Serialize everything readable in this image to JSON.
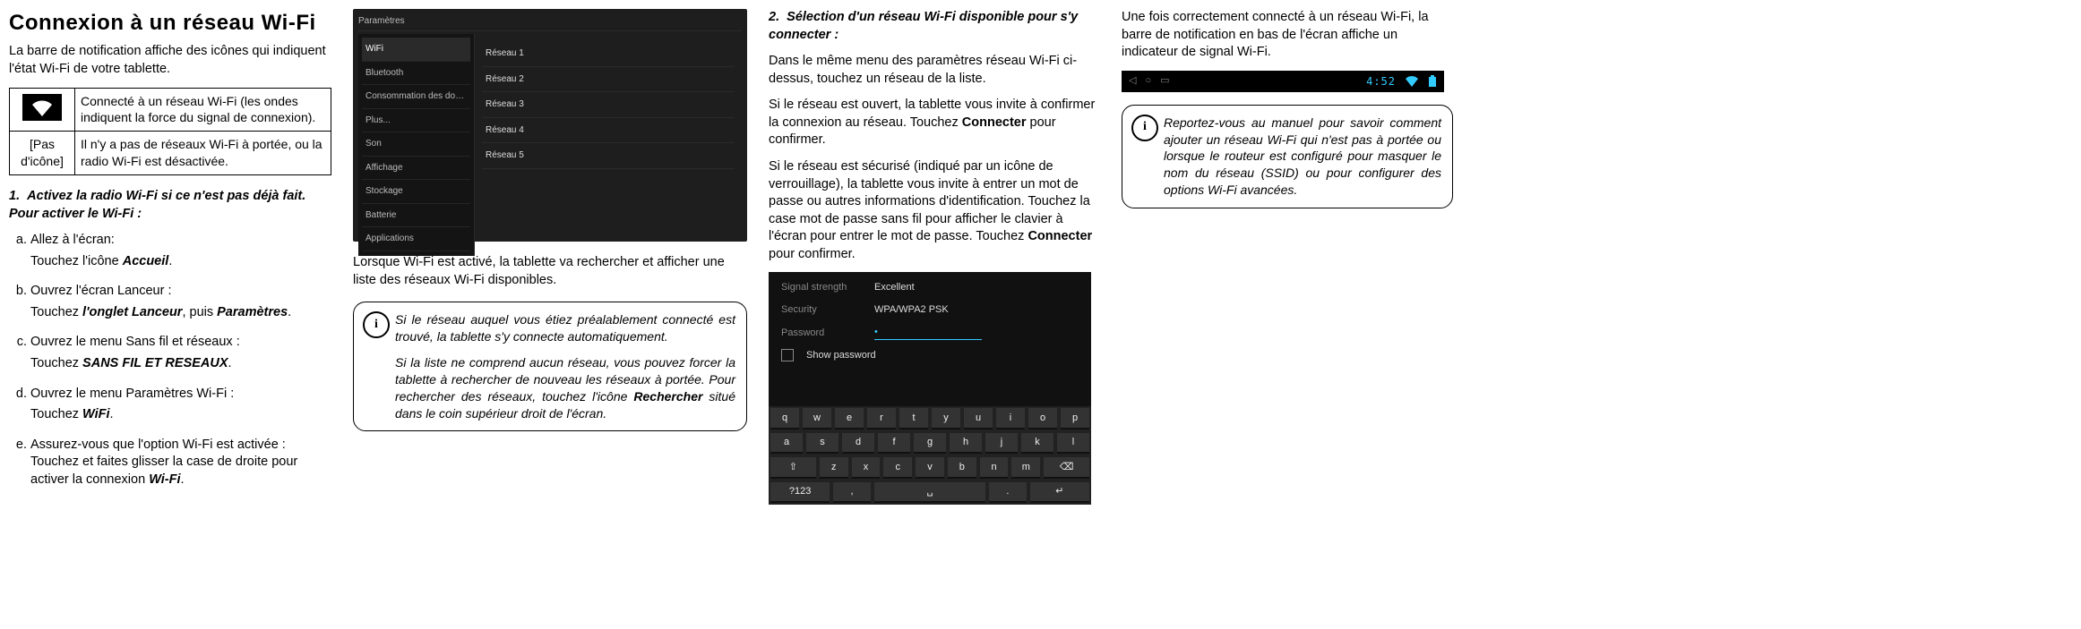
{
  "title": "Connexion à un réseau Wi-Fi",
  "intro": "La barre de notification affiche des icônes qui indiquent l'état Wi-Fi de votre tablette.",
  "status_table": {
    "row1": {
      "icon_name": "wifi-icon",
      "desc": "Connecté à un réseau Wi-Fi (les ondes indiquent la force du signal de connexion)."
    },
    "row2": {
      "label": "[Pas d'icône]",
      "desc": "Il n'y a pas de réseaux Wi-Fi à portée, ou la radio Wi-Fi est désactivée."
    }
  },
  "step1": {
    "lead_prefix": "1.",
    "lead": "Activez la radio Wi-Fi si ce n'est pas déjà fait. Pour activer le Wi-Fi :",
    "a": {
      "text": "Allez à l'écran:",
      "instr": "Touchez l'icône ",
      "instr_b": "Accueil",
      "instr_suffix": "."
    },
    "b": {
      "text": "Ouvrez l'écran Lanceur :",
      "instr": "Touchez ",
      "instr_b": "l'onglet Lanceur",
      "instr_mid": ", puis ",
      "instr_b2": "Paramètres",
      "instr_suffix": "."
    },
    "c": {
      "text": "Ouvrez le menu Sans fil et réseaux :",
      "instr": "Touchez ",
      "instr_b": "SANS FIL ET RESEAUX",
      "instr_suffix": "."
    },
    "d": {
      "text": "Ouvrez le menu Paramètres Wi-Fi :",
      "instr": "Touchez ",
      "instr_b": "WiFi",
      "instr_suffix": "."
    },
    "e": {
      "text": "Assurez-vous que l'option Wi-Fi est activée : Touchez et faites glisser la case de droite pour activer la connexion ",
      "text_b": "Wi-Fi",
      "text_suffix": "."
    }
  },
  "screenshot1": {
    "header_title": "Paramètres",
    "sidebar": [
      "WiFi",
      "Bluetooth",
      "Consommation des données",
      "Plus...",
      "Son",
      "Affichage",
      "Stockage",
      "Batterie",
      "Applications"
    ],
    "networks": [
      "Réseau 1",
      "Réseau 2",
      "Réseau 3",
      "Réseau 4",
      "Réseau 5"
    ]
  },
  "col2_para": "Lorsque Wi-Fi est activé, la tablette va rechercher et afficher une liste des réseaux Wi-Fi disponibles.",
  "note1": {
    "p1": "Si le réseau auquel vous étiez préalablement connecté est trouvé, la tablette s'y connecte automatiquement.",
    "p2_a": "Si la liste ne comprend aucun réseau, vous pouvez forcer la tablette à rechercher de nouveau les réseaux à portée. Pour rechercher des réseaux, touchez l'icône ",
    "p2_b": "Rechercher",
    "p2_c": " situé dans le coin supérieur droit de l'écran."
  },
  "step2": {
    "lead_prefix": "2.",
    "lead": "Sélection d'un réseau Wi-Fi disponible pour s'y connecter :",
    "p1": "Dans le même menu des paramètres réseau Wi-Fi ci-dessus, touchez un réseau de la liste.",
    "p2_a": "Si le réseau est ouvert, la tablette vous invite à confirmer la connexion au réseau. Touchez ",
    "p2_b": "Connecter",
    "p2_c": " pour confirmer.",
    "p3_a": "Si le réseau est sécurisé (indiqué par un icône de verrouillage), la tablette vous invite à entrer un mot de passe ou autres informations d'identification. Touchez la case mot de passe sans fil pour afficher le clavier à l'écran pour entrer le mot de passe. Touchez ",
    "p3_b": "Connecter",
    "p3_c": " pour confirmer."
  },
  "kb_shot": {
    "field_signal_label": "Signal strength",
    "field_signal_value": "Excellent",
    "field_sec_label": "Security",
    "field_sec_value": "WPA/WPA2 PSK",
    "field_pass_label": "Password",
    "field_pass_value": "•",
    "show_pw": "Show password",
    "row1": [
      "q",
      "w",
      "e",
      "r",
      "t",
      "y",
      "u",
      "i",
      "o",
      "p"
    ],
    "row2": [
      "a",
      "s",
      "d",
      "f",
      "g",
      "h",
      "j",
      "k",
      "l"
    ],
    "row3": [
      "⇧",
      "z",
      "x",
      "c",
      "v",
      "b",
      "n",
      "m",
      "⌫"
    ],
    "row4": [
      "?123",
      ",",
      "␣",
      ".",
      "↵"
    ]
  },
  "col4": {
    "p1": "Une fois correctement connecté à un réseau Wi-Fi, la barre de notification en bas de l'écran affiche un indicateur de signal Wi-Fi."
  },
  "notif_bar": {
    "time": "4:52",
    "wifi_name": "wifi-signal-icon",
    "batt_name": "battery-icon"
  },
  "note2": {
    "p": "Reportez-vous au manuel pour savoir comment ajouter un réseau Wi-Fi qui n'est pas à portée ou lorsque le routeur est configuré pour masquer le nom du réseau (SSID) ou pour configurer des options Wi-Fi avancées."
  }
}
